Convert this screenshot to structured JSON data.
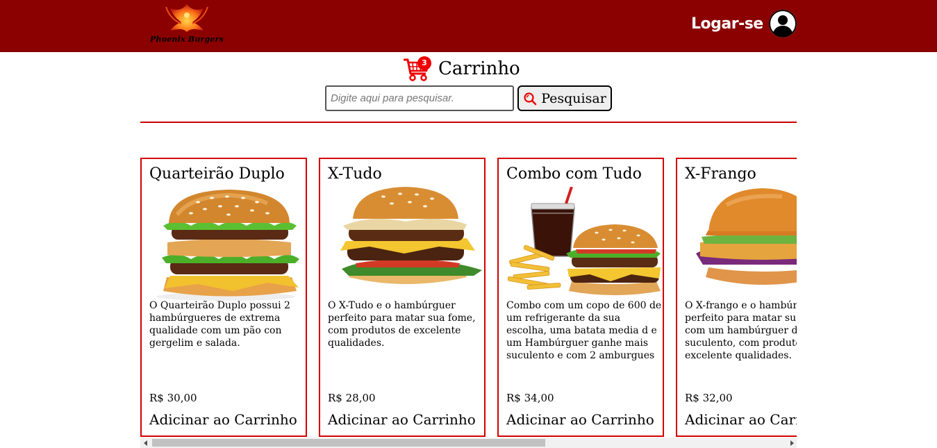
{
  "header": {
    "logo_text": "Phoenix Burgers",
    "login_label": "Logar-se",
    "background": "#8b0000"
  },
  "cart": {
    "label": "Carrinho",
    "count": "3"
  },
  "search": {
    "placeholder": "Digite aqui para pesquisar.",
    "value": "",
    "button_label": "Pesquisar"
  },
  "products": [
    {
      "name": "Quarteirão Duplo",
      "description": "O Quarteirão Duplo possui 2 hambúrgueres de extrema qualidade com um pão con gergelim e salada.",
      "price": "R$ 30,00",
      "button_label": "Adicinar ao Carrinho",
      "image": "double-burger"
    },
    {
      "name": "X-Tudo",
      "description": "O X-Tudo e o hambúrguer perfeito para matar sua fome, com produtos de excelente qualidades.",
      "price": "R$ 28,00",
      "button_label": "Adicinar ao Carrinho",
      "image": "x-tudo-burger"
    },
    {
      "name": "Combo com Tudo",
      "description": "Combo com um copo de 600 de um refrigerante da sua escolha, uma batata media d e um Hambúrguer ganhe mais suculento e com 2 amburgues",
      "price": "R$ 34,00",
      "button_label": "Adicinar ao Carrinho",
      "image": "combo-meal"
    },
    {
      "name": "X-Frango",
      "description": "O X-frango e o hambúrguer perfeito para matar sua fome e com um hambúrguer de frango suculento, com produtos de excelente qualidades.",
      "price": "R$ 32,00",
      "button_label": "Adicinar ao Carrinho",
      "image": "chicken-burger"
    }
  ],
  "colors": {
    "accent": "#d40000",
    "header_bg": "#8b0000"
  }
}
